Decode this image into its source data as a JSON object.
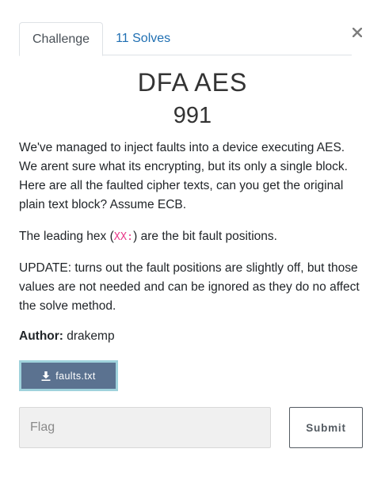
{
  "tabs": [
    {
      "label": "Challenge",
      "active": true
    },
    {
      "label": "11 Solves",
      "active": false
    }
  ],
  "close_label": "×",
  "challenge": {
    "name": "DFA AES",
    "value": "991",
    "description": {
      "p1": "We've managed to inject faults into a device executing AES. We arent sure what its encrypting, but its only a single block. Here are all the faulted cipher texts, can you get the original plain text block? Assume ECB.",
      "p2_before": "The leading hex (",
      "p2_code": "XX:",
      "p2_after": ") are the bit fault positions.",
      "p3": "UPDATE: turns out the fault positions are slightly off, but those values are not needed and can be ignored as they do no affect the solve method."
    },
    "author_label": "Author:",
    "author": "drakemp",
    "file": "faults.txt"
  },
  "form": {
    "placeholder": "Flag",
    "value": "",
    "submit_label": "Submit"
  },
  "colors": {
    "tab_link": "#1f6fb2",
    "file_button": "#5b7290",
    "file_button_border": "#9fd2dc",
    "code": "#e83e8c",
    "input_bg": "#f0f0f0"
  },
  "icons": {
    "close": "close-icon",
    "download": "download-icon"
  }
}
